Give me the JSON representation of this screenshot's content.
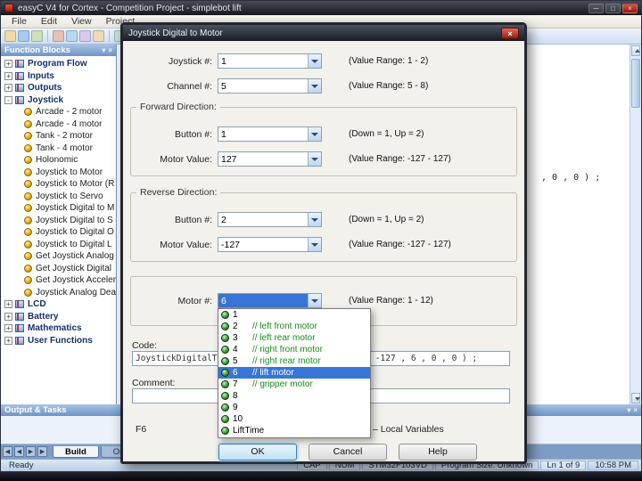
{
  "titlebar": {
    "title": "easyC V4 for Cortex - Competition Project - simplebot lift",
    "min": "─",
    "max": "□",
    "close": "×"
  },
  "menubar": {
    "items": [
      {
        "label": "File"
      },
      {
        "label": "Edit"
      },
      {
        "label": "View"
      },
      {
        "label": "Project"
      }
    ]
  },
  "sidebar": {
    "header": "Function Blocks",
    "pin": "▾",
    "close": "×",
    "tree": [
      {
        "label": "Program Flow",
        "cls": "folder",
        "glyph": "+"
      },
      {
        "label": "Inputs",
        "cls": "folder",
        "glyph": "+"
      },
      {
        "label": "Outputs",
        "cls": "folder",
        "glyph": "+"
      },
      {
        "label": "Joystick",
        "cls": "folder",
        "glyph": "-"
      },
      {
        "label": "Arcade - 2 motor",
        "cls": "block"
      },
      {
        "label": "Arcade - 4 motor",
        "cls": "block"
      },
      {
        "label": "Tank - 2 motor",
        "cls": "block"
      },
      {
        "label": "Tank - 4 motor",
        "cls": "block"
      },
      {
        "label": "Holonomic",
        "cls": "block"
      },
      {
        "label": "Joystick to Motor",
        "cls": "block"
      },
      {
        "label": "Joystick to Motor (R",
        "cls": "block"
      },
      {
        "label": "Joystick to Servo",
        "cls": "block"
      },
      {
        "label": "Joystick Digital to M",
        "cls": "block"
      },
      {
        "label": "Joystick Digital to S",
        "cls": "block"
      },
      {
        "label": "Joystick to Digital O",
        "cls": "block"
      },
      {
        "label": "Joystick to Digital L",
        "cls": "block"
      },
      {
        "label": "Get Joystick Analog",
        "cls": "block"
      },
      {
        "label": "Get Joystick Digital",
        "cls": "block"
      },
      {
        "label": "Get Joystick Accelero",
        "cls": "block"
      },
      {
        "label": "Joystick Analog Dead",
        "cls": "block"
      },
      {
        "label": "LCD",
        "cls": "folder",
        "glyph": "+"
      },
      {
        "label": "Battery",
        "cls": "folder",
        "glyph": "+"
      },
      {
        "label": "Mathematics",
        "cls": "folder",
        "glyph": "+"
      },
      {
        "label": "User Functions",
        "cls": "folder",
        "glyph": "+"
      }
    ]
  },
  "editor": {
    "code_fragment": ", 0 , 0 ) ;"
  },
  "dialog": {
    "title": "Joystick Digital to Motor",
    "close": "×",
    "joystick_row": {
      "label": "Joystick #:",
      "value": "1",
      "range": "(Value Range: 1 - 2)"
    },
    "channel_row": {
      "label": "Channel #:",
      "value": "5",
      "range": "(Value Range: 5 - 8)"
    },
    "forward": {
      "title": "Forward Direction:",
      "button_row": {
        "label": "Button #:",
        "value": "1",
        "range": "(Down = 1, Up = 2)"
      },
      "motor_row": {
        "label": "Motor Value:",
        "value": "127",
        "range": "(Value Range: -127 - 127)"
      }
    },
    "reverse": {
      "title": "Reverse Direction:",
      "button_row": {
        "label": "Button #:",
        "value": "2",
        "range": "(Down = 1, Up = 2)"
      },
      "motor_row": {
        "label": "Motor Value:",
        "value": "-127",
        "range": "(Value Range: -127 - 127)"
      }
    },
    "motor_row": {
      "label": "Motor #:",
      "value": "6",
      "range": "(Value Range: 1 - 12)"
    },
    "dropdown": [
      {
        "num": "1",
        "comment": ""
      },
      {
        "num": "2",
        "comment": "// left front motor"
      },
      {
        "num": "3",
        "comment": "// left rear motor"
      },
      {
        "num": "4",
        "comment": "// right front motor"
      },
      {
        "num": "5",
        "comment": "// right rear motor"
      },
      {
        "num": "6",
        "comment": "// lift motor",
        "cls": "sel"
      },
      {
        "num": "7",
        "comment": "// gripper motor"
      },
      {
        "num": "8",
        "comment": ""
      },
      {
        "num": "9",
        "comment": ""
      },
      {
        "num": "10",
        "comment": ""
      },
      {
        "num": "LiftTime",
        "comment": ""
      }
    ],
    "code_label": "Code:",
    "code_value": "JoystickDigitalToMotor ( 1 , 5 , 1 , 127 , 2 , -127 , 6 , 0 , 0 ) ;",
    "comment_label": "Comment:",
    "comment_value": "",
    "hint_left": "F6",
    "hint_right": "– Local Variables",
    "buttons": [
      {
        "label": "OK",
        "cls": "primary"
      },
      {
        "label": "Cancel"
      },
      {
        "label": "Help"
      }
    ]
  },
  "output_panel": {
    "header": "Output & Tasks",
    "pin": "▾",
    "close": "×"
  },
  "tabs": {
    "arrows": [
      "◀",
      "◀",
      "▶",
      "▶"
    ],
    "items": [
      {
        "label": "Build",
        "cls": "active"
      },
      {
        "label": "Output"
      }
    ]
  },
  "statusbar": {
    "ready": "Ready",
    "segments": [
      {
        "label": "CAP"
      },
      {
        "label": "NUM"
      },
      {
        "label": "STM32F103VD"
      },
      {
        "label": "Program Size: Unknown"
      },
      {
        "label": "Ln 1 of 9"
      }
    ],
    "time": "10:58 PM"
  }
}
